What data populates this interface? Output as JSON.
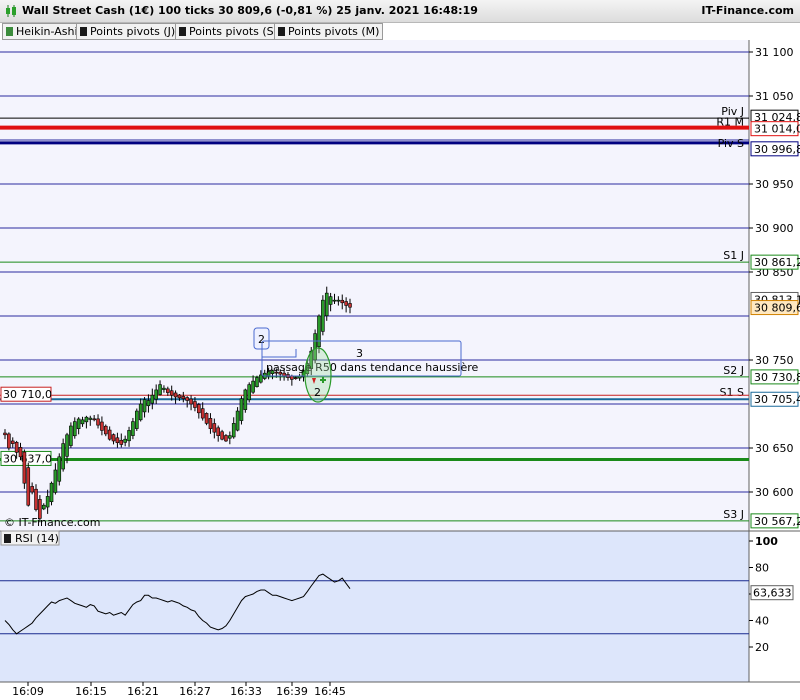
{
  "header": {
    "title": "Wall Street Cash (1€) 100 ticks 30 809,6 (-0,81 %) 25 janv. 2021 16:48:19",
    "brand": "IT-Finance.com"
  },
  "legend": [
    {
      "label": "Heikin-Ashi",
      "color": "#3c8c3c"
    },
    {
      "label": "Points pivots (J)",
      "color": "#1a6a1a"
    },
    {
      "label": "Points pivots (S)",
      "color": "#1a6a1a"
    },
    {
      "label": "Points pivots (M)",
      "color": "#1a6a1a"
    }
  ],
  "watermark": "© IT-Finance.com",
  "colors": {
    "up_candle": "#2a9a2a",
    "down_candle": "#c83232",
    "grid": "#2a2aa0",
    "pivot_green": "#1a8a1a",
    "r1m_red": "#e01010",
    "price_bg": "#ffe8c0"
  },
  "chart_data": [
    {
      "type": "candlestick",
      "title": "Wall Street Cash (1€) 100 ticks",
      "ylim": [
        30560,
        31130
      ],
      "price_ticks": [
        31100,
        31050,
        30950,
        30900,
        30850,
        30750,
        30650,
        30600
      ],
      "price_tick_labels": [
        "31 100",
        "31 050",
        "30 950",
        "30 900",
        "30 850",
        "30 750",
        "30 650",
        "30 600"
      ],
      "time_labels": [
        "16:09",
        "16:15",
        "16:21",
        "16:27",
        "16:33",
        "16:39",
        "16:45"
      ],
      "pivot_levels": [
        {
          "name": "Piv J",
          "value": 31024.8,
          "value_label": "31 024,8",
          "color": "#000000"
        },
        {
          "name": "R1 M",
          "value": 31014.0,
          "value_label": "31 014,0",
          "color": "#e01010"
        },
        {
          "name": "Piv S",
          "value": 30996.8,
          "value_label": "30 996,8",
          "color": "#000080"
        },
        {
          "name": "S1 J",
          "value": 30861.2,
          "value_label": "30 861,2",
          "color": "#1a8a1a"
        },
        {
          "name": "S2 J",
          "value": 30730.8,
          "value_label": "30 730,8",
          "color": "#1a8a1a"
        },
        {
          "name": "S1 S",
          "value": 30705.4,
          "value_label": "30 705,4",
          "color": "#1a6a9a"
        },
        {
          "name": "S3 J",
          "value": 30567.2,
          "value_label": "30 567,2",
          "color": "#1a8a1a"
        }
      ],
      "extra_levels": [
        {
          "value": 30710.0,
          "value_label": "30 710,0",
          "color": "#c82020"
        },
        {
          "value": 30637.0,
          "value_label": "30 637,0",
          "color": "#1a8a1a"
        }
      ],
      "markers": [
        {
          "value": 30813.1,
          "value_label": "30 813,1",
          "kind": "high"
        },
        {
          "value": 30809.6,
          "value_label": "30 809,6",
          "kind": "last"
        }
      ],
      "annotation": {
        "text": "passage R50 dans tendance haussière",
        "numbers": [
          "2",
          "3"
        ],
        "circle_number": "2"
      },
      "series_close": [
        30665,
        30650,
        30655,
        30645,
        30640,
        30610,
        30585,
        30600,
        30580,
        30570,
        30585,
        30595,
        30610,
        30625,
        30640,
        30655,
        30665,
        30675,
        30680,
        30683,
        30682,
        30685,
        30684,
        30683,
        30676,
        30670,
        30666,
        30660,
        30658,
        30656,
        30654,
        30660,
        30670,
        30680,
        30692,
        30700,
        30705,
        30704,
        30710,
        30716,
        30722,
        30718,
        30713,
        30710,
        30708,
        30707,
        30706,
        30704,
        30700,
        30696,
        30690,
        30684,
        30678,
        30672,
        30668,
        30664,
        30660,
        30658,
        30664,
        30678,
        30692,
        30706,
        30716,
        30722,
        30726,
        30730,
        30733,
        30735,
        30737,
        30738,
        30736,
        30734,
        30732,
        30730,
        30728,
        30729,
        30732,
        30738,
        30746,
        30760,
        30780,
        30800,
        30818,
        30826,
        30822,
        30818,
        30818,
        30815,
        30812,
        30810
      ]
    },
    {
      "type": "line",
      "title": "RSI (14)",
      "ylim": [
        20,
        100
      ],
      "ticks": [
        100,
        80,
        60,
        40,
        20
      ],
      "tick_labels": [
        "100",
        "80",
        "60",
        "40",
        "20"
      ],
      "guides": [
        70,
        30
      ],
      "last_value_label": "63,633",
      "values": [
        40,
        37,
        33,
        30,
        32,
        34,
        36,
        38,
        42,
        45,
        48,
        51,
        54,
        53,
        55,
        56,
        57,
        55,
        53,
        52,
        51,
        50,
        52,
        51,
        47,
        46,
        45,
        46,
        44,
        45,
        46,
        44,
        48,
        52,
        54,
        55,
        59,
        59,
        57,
        57,
        56,
        55,
        54,
        55,
        54,
        53,
        51,
        50,
        48,
        47,
        43,
        40,
        38,
        35,
        34,
        33,
        34,
        36,
        40,
        45,
        50,
        55,
        58,
        59,
        60,
        62,
        63,
        63,
        61,
        59,
        59,
        58,
        57,
        56,
        55,
        56,
        57,
        58,
        62,
        66,
        70,
        74,
        75,
        73,
        71,
        69,
        70,
        72,
        68,
        64
      ]
    }
  ]
}
